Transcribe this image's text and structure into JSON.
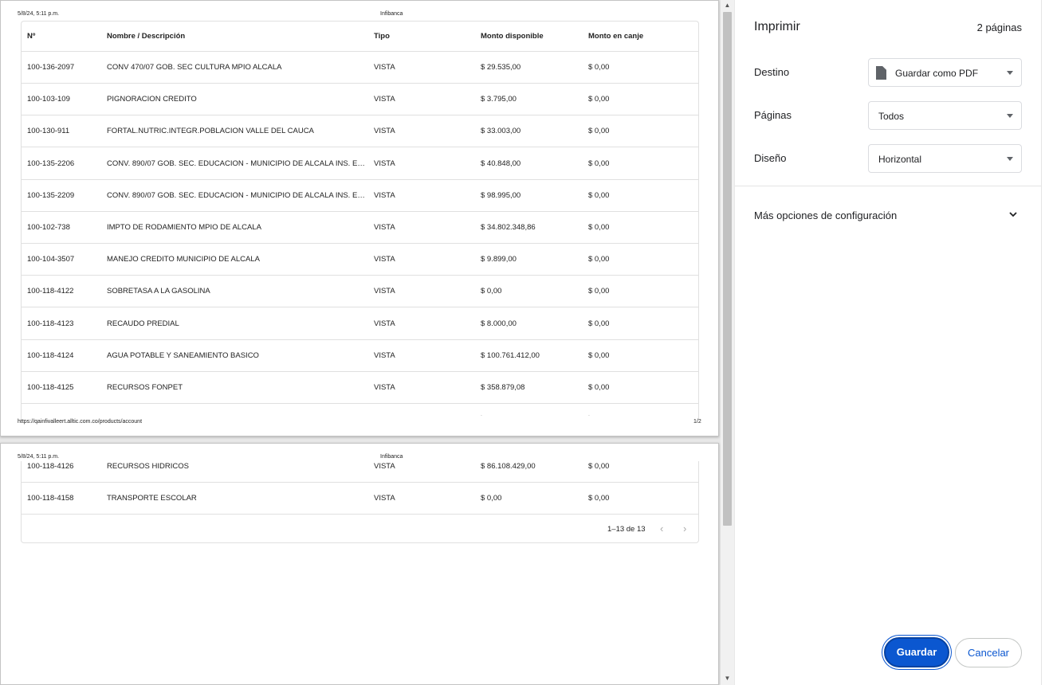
{
  "preview": {
    "header_date": "5/8/24, 5:11 p.m.",
    "header_site": "Infibanca",
    "footer_url": "https://qainfivalleert.alltic.com.co/products/account",
    "page_number": "1/2"
  },
  "table": {
    "columns": [
      "Nº",
      "Nombre / Descripción",
      "Tipo",
      "Monto disponible",
      "Monto en canje"
    ],
    "rows": [
      {
        "numero": "100-136-2097",
        "nombre": "CONV 470/07 GOB. SEC CULTURA MPIO ALCALA",
        "tipo": "VISTA",
        "disponible": "$ 29.535,00",
        "canje": "$ 0,00"
      },
      {
        "numero": "100-103-109",
        "nombre": "PIGNORACION CREDITO",
        "tipo": "VISTA",
        "disponible": "$ 3.795,00",
        "canje": "$ 0,00"
      },
      {
        "numero": "100-130-911",
        "nombre": "FORTAL.NUTRIC.INTEGR.POBLACION VALLE DEL CAUCA",
        "tipo": "VISTA",
        "disponible": "$ 33.003,00",
        "canje": "$ 0,00"
      },
      {
        "numero": "100-135-2206",
        "nombre": "CONV. 890/07 GOB. SEC. EDUCACION - MUNICIPIO DE ALCALA INS. EDU...",
        "tipo": "VISTA",
        "disponible": "$ 40.848,00",
        "canje": "$ 0,00"
      },
      {
        "numero": "100-135-2209",
        "nombre": "CONV. 890/07 GOB. SEC. EDUCACION - MUNICIPIO DE ALCALA INS. EDU...",
        "tipo": "VISTA",
        "disponible": "$ 98.995,00",
        "canje": "$ 0,00"
      },
      {
        "numero": "100-102-738",
        "nombre": "IMPTO DE RODAMIENTO MPIO DE ALCALA",
        "tipo": "VISTA",
        "disponible": "$ 34.802.348,86",
        "canje": "$ 0,00"
      },
      {
        "numero": "100-104-3507",
        "nombre": "MANEJO CREDITO MUNICIPIO DE ALCALA",
        "tipo": "VISTA",
        "disponible": "$ 9.899,00",
        "canje": "$ 0,00"
      },
      {
        "numero": "100-118-4122",
        "nombre": "SOBRETASA A LA GASOLINA",
        "tipo": "VISTA",
        "disponible": "$ 0,00",
        "canje": "$ 0,00"
      },
      {
        "numero": "100-118-4123",
        "nombre": "RECAUDO PREDIAL",
        "tipo": "VISTA",
        "disponible": "$ 8.000,00",
        "canje": "$ 0,00"
      },
      {
        "numero": "100-118-4124",
        "nombre": "AGUA POTABLE Y SANEAMIENTO BASICO",
        "tipo": "VISTA",
        "disponible": "$ 100.761.412,00",
        "canje": "$ 0,00"
      },
      {
        "numero": "100-118-4125",
        "nombre": "RECURSOS FONPET",
        "tipo": "VISTA",
        "disponible": "$ 358.879,08",
        "canje": "$ 0,00"
      }
    ],
    "rows_page2": [
      {
        "numero": "100-118-4126",
        "nombre": "RECURSOS HIDRICOS",
        "tipo": "VISTA",
        "disponible": "$ 86.108.429,00",
        "canje": "$ 0,00"
      },
      {
        "numero": "100-118-4158",
        "nombre": "TRANSPORTE ESCOLAR",
        "tipo": "VISTA",
        "disponible": "$ 0,00",
        "canje": "$ 0,00"
      }
    ],
    "pagination": "1–13 de 13"
  },
  "panel": {
    "title": "Imprimir",
    "page_count": "2 páginas",
    "destination_label": "Destino",
    "destination_value": "Guardar como PDF",
    "pages_label": "Páginas",
    "pages_value": "Todos",
    "layout_label": "Diseño",
    "layout_value": "Horizontal",
    "more_options": "Más opciones de configuración",
    "save": "Guardar",
    "cancel": "Cancelar"
  },
  "colors": {
    "primary": "#0b57d0",
    "border": "#dadce0",
    "text": "#202124"
  },
  "icons": {
    "destination": "file-icon",
    "more": "chevron-down-icon",
    "prev": "chevron-left-icon",
    "next": "chevron-right-icon"
  }
}
